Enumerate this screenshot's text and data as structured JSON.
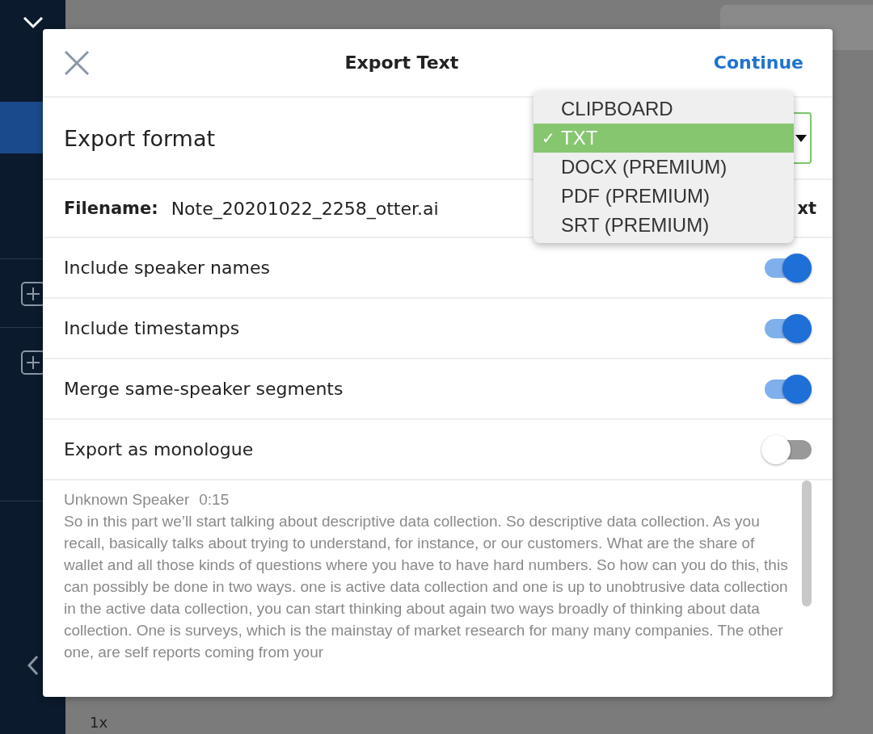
{
  "background": {
    "speed": "1x"
  },
  "dialog": {
    "title": "Export Text",
    "continue": "Continue",
    "format": {
      "label": "Export format",
      "check_mark": "✓",
      "options": [
        {
          "label": "CLIPBOARD",
          "selected": false
        },
        {
          "label": "TXT",
          "selected": true
        },
        {
          "label": "DOCX (PREMIUM)",
          "selected": false
        },
        {
          "label": "PDF (PREMIUM)",
          "selected": false
        },
        {
          "label": "SRT (PREMIUM)",
          "selected": false
        }
      ]
    },
    "filename": {
      "label": "Filename:",
      "value": "Note_20201022_2258_otter.ai",
      "action": "xt"
    },
    "options": [
      {
        "label": "Include speaker names",
        "on": true
      },
      {
        "label": "Include timestamps",
        "on": true
      },
      {
        "label": "Merge same-speaker segments",
        "on": true
      },
      {
        "label": "Export as monologue",
        "on": false
      }
    ],
    "preview": {
      "speaker": "Unknown Speaker",
      "time": "0:15",
      "text": "So in this part we’ll start talking about descriptive data collection. So descriptive data collection. As you recall, basically talks about trying to understand, for instance, or our customers. What are the share of wallet and all those kinds of questions where you have to have hard numbers. So how can you do this, this can possibly be done in two ways. one is active data collection and one is up to unobtrusive data collection in the active data collection, you can start thinking about again two ways broadly of thinking about data collection. One is surveys, which is the mainstay of market research for many many companies. The other one, are self reports coming from your"
    }
  }
}
